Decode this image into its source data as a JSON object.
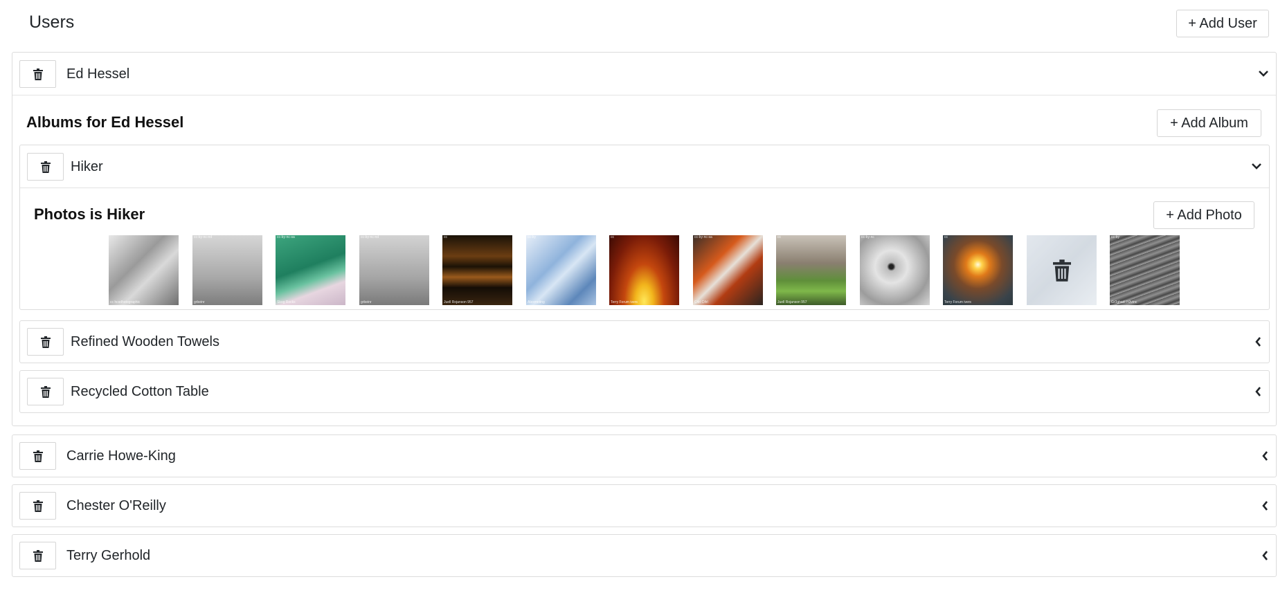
{
  "header": {
    "title": "Users",
    "add_user_label": "+ Add User"
  },
  "users": [
    {
      "name": "Ed Hessel",
      "expanded": true,
      "albums_title": "Albums for Ed Hessel",
      "add_album_label": "+ Add Album",
      "albums": [
        {
          "name": "Hiker",
          "expanded": true,
          "photos_title": "Photos is Hiker",
          "add_photo_label": "+ Add Photo",
          "photos": [
            {
              "tag": "",
              "caption": "cc hcsdhotographic",
              "bg": "linear-gradient(135deg,#e8e8e8,#9a9a9a 40%,#d9d9d9 60%,#6f6f6f)"
            },
            {
              "tag": "cc-by-nc-nd",
              "caption": "grbeinr",
              "bg": "linear-gradient(180deg,#d6d6d6,#a9a9a9 60%,#7d7d7d)"
            },
            {
              "tag": "cc-by-nc-sa",
              "caption": "Skog Rocks",
              "bg": "linear-gradient(160deg,#3da57e,#1f7f5f 45%,#6ac2a0 62%,#e7d6e0 75%,#cbb6c8)"
            },
            {
              "tag": "cc-by-nc-nd",
              "caption": "grbeinr",
              "bg": "linear-gradient(180deg,#d3d3d3,#a6a6a6 60%,#7a7a7a)"
            },
            {
              "tag": "cc",
              "caption": "Juell Rojanson 957",
              "bg": "linear-gradient(180deg,#1a1208,#6b3d12 30%,#1b1206 45%,#9a5a1c 60%,#140d06 75%,#3a2510)"
            },
            {
              "tag": "cc-by",
              "caption": "Alexmeting",
              "bg": "linear-gradient(135deg,#e6eef8,#8fb3dc 40%,#d8e6f4 55%,#5d87ba 80%,#a9c3e2)"
            },
            {
              "tag": "cc",
              "caption": "Terry Forum ivers",
              "bg": "radial-gradient(ellipse at 50% 95%,#ffe85a 0%,#f2b51c 18%,#c4470e 40%,#7a1c08 70%,#3a0a04 100%)"
            },
            {
              "tag": "cc-by-nc-sa",
              "caption": "C4rl C4rl",
              "bg": "linear-gradient(135deg,#3a2e28,#d65a1c 35%,#e6e0d8 50%,#b23c12 65%,#2b2420)"
            },
            {
              "tag": "cc",
              "caption": "Juell Rojanson 957",
              "bg": "linear-gradient(180deg,#c9c2b8,#8a7f70 40%,#5f8f3a 65%,#7fb84a 80%,#3e5c2a)"
            },
            {
              "tag": "cc-by-nc",
              "caption": "",
              "bg": "radial-gradient(circle at 45% 45%,#222 0%,#222 4%,#bdbdbd 8%,#e4e4e4 30%,#9c9c9c 70%,#d7d7d7)"
            },
            {
              "tag": "cc",
              "caption": "Terry Forum ivers",
              "bg": "radial-gradient(circle at 50% 42%,#fffbe0 0%,#ffd24a 8%,#e07a1a 22%,#7a4a2a 45%,#39434a 80%,#2e3a40)"
            },
            {
              "tag": "",
              "caption": "",
              "bg": "linear-gradient(135deg,#d9e0e8,#c5ced8 50%,#e2e8ee)",
              "hovered": true
            },
            {
              "tag": "cc-by",
              "caption": "Gr3ghadi H3vinc",
              "bg": "repeating-linear-gradient(160deg,#5a5a5a 0px,#8f8f8f 5px,#474747 10px,#a8a8a8 14px)"
            }
          ]
        },
        {
          "name": "Refined Wooden Towels",
          "expanded": false
        },
        {
          "name": "Recycled Cotton Table",
          "expanded": false
        }
      ]
    },
    {
      "name": "Carrie Howe-King",
      "expanded": false
    },
    {
      "name": "Chester O'Reilly",
      "expanded": false
    },
    {
      "name": "Terry Gerhold",
      "expanded": false
    }
  ],
  "icons": {
    "delete": "trash-icon",
    "expanded": "chevron-down-icon",
    "collapsed": "chevron-left-icon"
  }
}
